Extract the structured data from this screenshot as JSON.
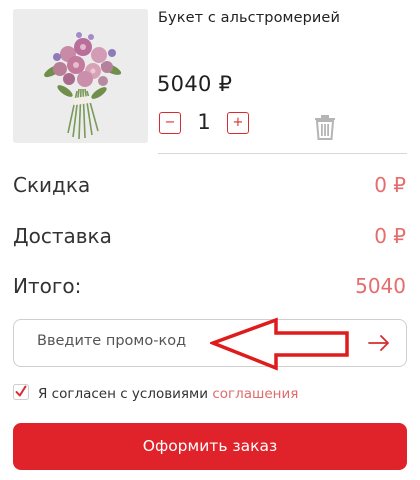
{
  "product": {
    "name": "Букет с альстромерией",
    "price": "5040 ₽",
    "quantity": "1",
    "minus_label": "−",
    "plus_label": "+",
    "image_icon": "bouquet-photo",
    "delete_icon": "trash-icon"
  },
  "summary": {
    "discount_label": "Скидка",
    "discount_value": "0 ₽",
    "delivery_label": "Доставка",
    "delivery_value": "0 ₽",
    "total_label": "Итого:",
    "total_value": "5040"
  },
  "promo": {
    "placeholder": "Введите промо-код",
    "submit_icon": "arrow-right-icon"
  },
  "agreement": {
    "checked": true,
    "text": "Я согласен с условиями",
    "link_text": "соглашения"
  },
  "checkout": {
    "button_label": "Оформить заказ"
  },
  "colors": {
    "accent": "#e0222b",
    "price_accent": "#e56d6d"
  }
}
